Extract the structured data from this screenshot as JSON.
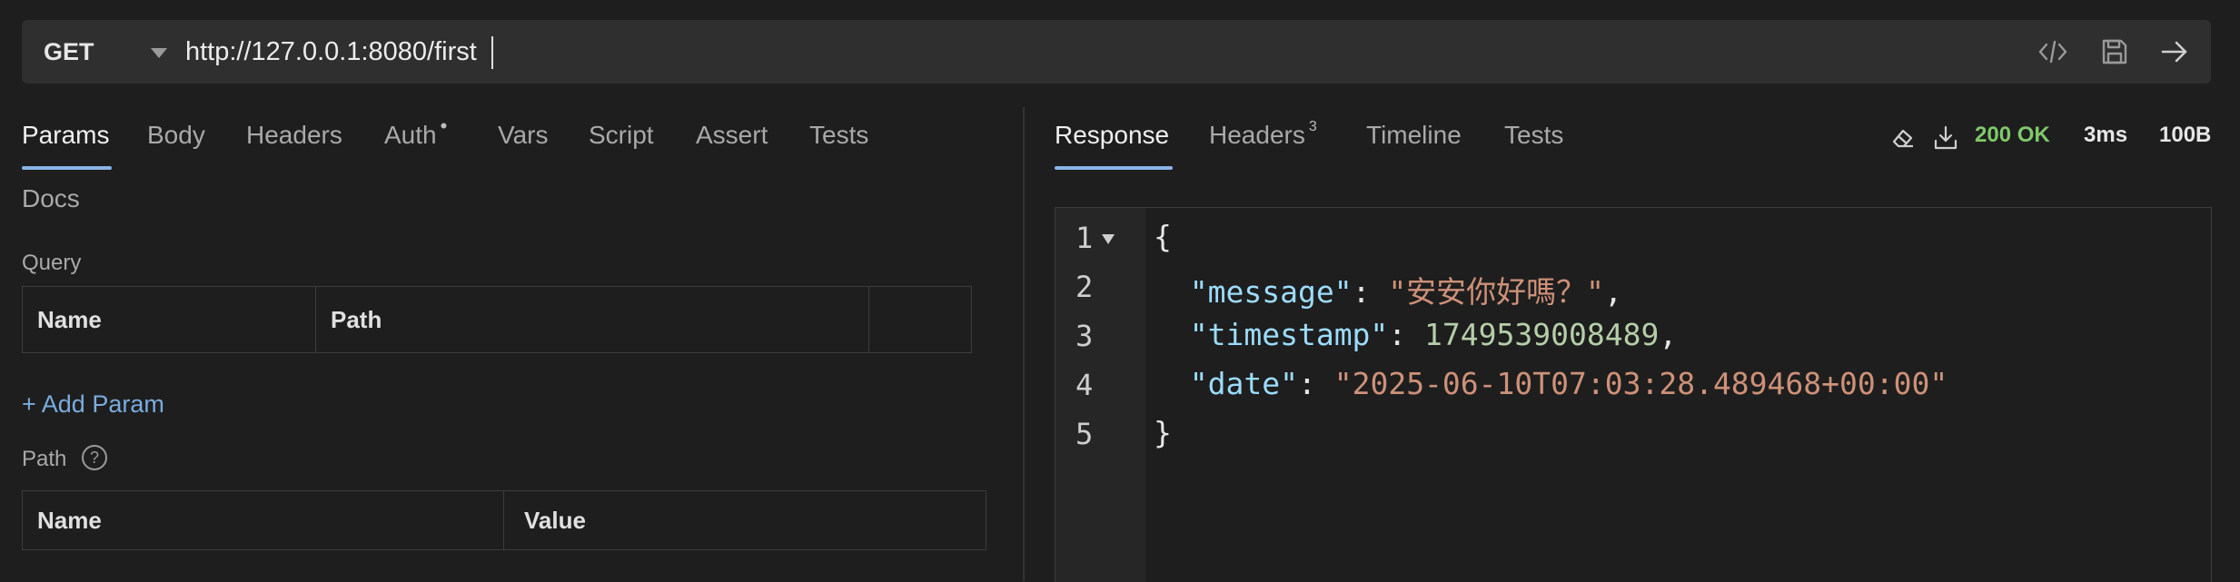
{
  "request": {
    "method": "GET",
    "url": "http://127.0.0.1:8080/first"
  },
  "url_icons": [
    "code-icon",
    "save-icon",
    "arrow-right-icon"
  ],
  "request_tabs": [
    {
      "label": "Params",
      "active": true
    },
    {
      "label": "Body"
    },
    {
      "label": "Headers"
    },
    {
      "label": "Auth",
      "indicator": "•"
    },
    {
      "label": "Vars"
    },
    {
      "label": "Script"
    },
    {
      "label": "Assert"
    },
    {
      "label": "Tests"
    },
    {
      "label": "Docs"
    }
  ],
  "query": {
    "label": "Query",
    "columns": [
      "Name",
      "Path"
    ],
    "add_label": "+ Add Param"
  },
  "path": {
    "label": "Path",
    "columns": [
      "Name",
      "Value"
    ]
  },
  "response_tabs": [
    {
      "label": "Response",
      "active": true
    },
    {
      "label": "Headers",
      "badge": "3"
    },
    {
      "label": "Timeline"
    },
    {
      "label": "Tests"
    }
  ],
  "response_meta": {
    "status": "200 OK",
    "time": "3ms",
    "size": "100B",
    "status_color": "#7fc96b"
  },
  "response_body": {
    "line_numbers": [
      "1",
      "2",
      "3",
      "4",
      "5"
    ],
    "open_brace": "{",
    "close_brace": "}",
    "fields": [
      {
        "key": "\"message\"",
        "value": "\"安安你好嗎？\"",
        "kind": "string",
        "trail": ","
      },
      {
        "key": "\"timestamp\"",
        "value": "1749539008489",
        "kind": "number",
        "trail": ","
      },
      {
        "key": "\"date\"",
        "value": "\"2025-06-10T07:03:28.489468+00:00\"",
        "kind": "string",
        "trail": ""
      }
    ]
  },
  "colors": {
    "accent": "#8ab4e8",
    "link": "#7aacdf",
    "json_key": "#9cdcfe",
    "json_string": "#ce9178",
    "json_number": "#b5cea8"
  }
}
